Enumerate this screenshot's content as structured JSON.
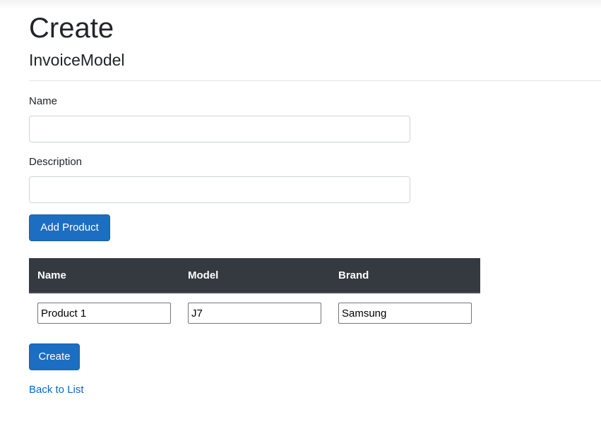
{
  "page": {
    "title": "Create",
    "subtitle": "InvoiceModel"
  },
  "form": {
    "name": {
      "label": "Name",
      "value": "",
      "placeholder": ""
    },
    "description": {
      "label": "Description",
      "value": "",
      "placeholder": ""
    },
    "add_product_label": "Add Product",
    "submit_label": "Create"
  },
  "products_table": {
    "columns": [
      "Name",
      "Model",
      "Brand"
    ],
    "rows": [
      {
        "name": "Product 1",
        "model": "J7",
        "brand": "Samsung"
      }
    ]
  },
  "links": {
    "back_to_list": "Back to List"
  },
  "colors": {
    "primary": "#1b6ec2",
    "table_header": "#343a40",
    "link": "#0366d6"
  }
}
